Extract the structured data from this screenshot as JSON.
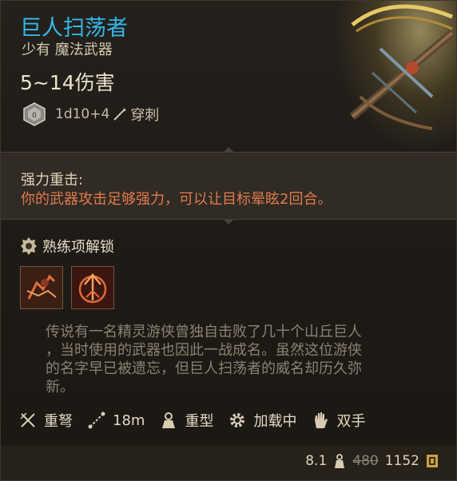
{
  "item": {
    "name": "巨人扫荡者",
    "subtitle": "少有 魔法武器",
    "damage": "5~14伤害",
    "dice_formula": "1d10+4",
    "damage_type": "穿刺"
  },
  "ability": {
    "title": "强力重击:",
    "description": "你的武器攻击足够强力，可以让目标晕眩2回合。"
  },
  "proficiency": {
    "label": "熟练项解锁",
    "skills": [
      "skill-1",
      "skill-2"
    ]
  },
  "lore": {
    "lines": [
      "传说有一名精灵游侠曾独自击败了几十个山丘巨人",
      "，当时使用的武器也因此一战成名。虽然这位游侠",
      "的名字早已被遗忘，但巨人扫荡者的威名却历久弥",
      "新。"
    ]
  },
  "properties": [
    {
      "icon": "crossbow-icon",
      "label": "重弩"
    },
    {
      "icon": "range-icon",
      "label": "18m"
    },
    {
      "icon": "heavy-icon",
      "label": "重型"
    },
    {
      "icon": "gear-icon",
      "label": "加载中"
    },
    {
      "icon": "hand-icon",
      "label": "双手"
    }
  ],
  "footer": {
    "weight": "8.1",
    "old_price": "480",
    "price": "1152"
  },
  "colors": {
    "name": "#35b7e8",
    "ability": "#e07a4c",
    "lore": "#8b8170"
  }
}
